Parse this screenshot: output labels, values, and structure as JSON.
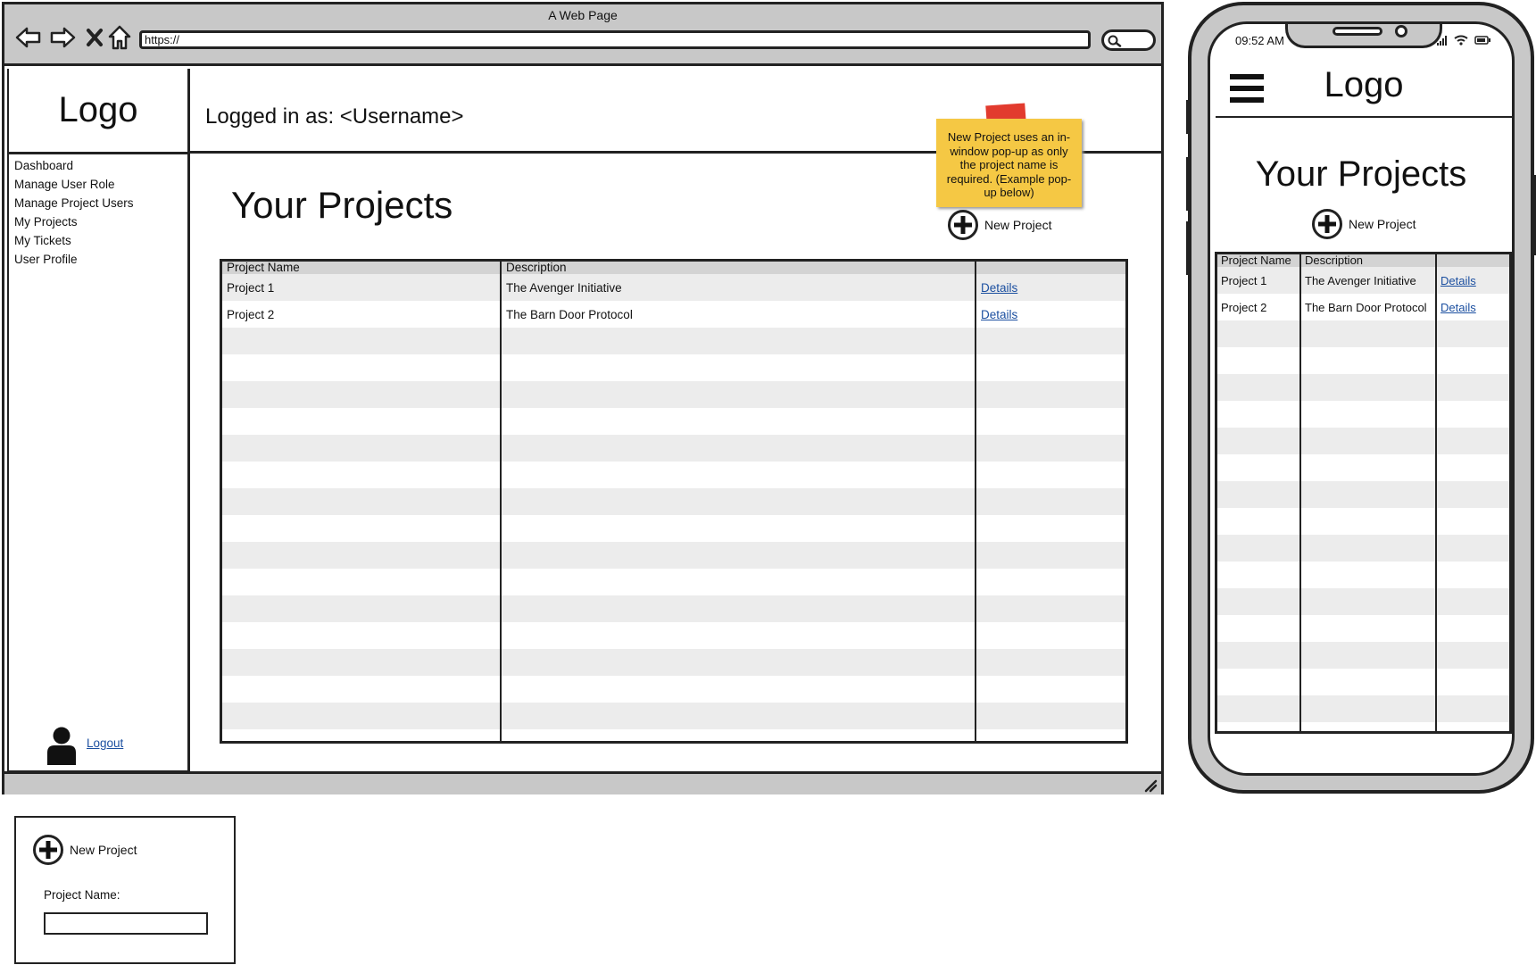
{
  "browser": {
    "window_title": "A Web Page",
    "address": "https://"
  },
  "sidebar": {
    "logo": "Logo",
    "items": [
      {
        "label": "Dashboard"
      },
      {
        "label": "Manage User Role"
      },
      {
        "label": "Manage Project Users"
      },
      {
        "label": "My Projects"
      },
      {
        "label": "My Tickets"
      },
      {
        "label": "User Profile"
      }
    ],
    "logout_label": "Logout"
  },
  "header": {
    "logged_in_text": "Logged in as: <Username>"
  },
  "sticky_note": {
    "text": "New Project uses an in-window pop-up as only the project name is required. (Example pop-up below)"
  },
  "main": {
    "title": "Your Projects",
    "new_project_label": "New Project",
    "table": {
      "columns": [
        "Project Name",
        "Description",
        ""
      ],
      "rows": [
        {
          "name": "Project 1",
          "description": "The Avenger Initiative",
          "link": "Details"
        },
        {
          "name": "Project 2",
          "description": "The Barn Door Protocol",
          "link": "Details"
        }
      ]
    }
  },
  "mobile": {
    "time": "09:52 AM",
    "logo": "Logo",
    "title": "Your Projects",
    "new_project_label": "New Project",
    "table": {
      "columns": [
        "Project Name",
        "Description",
        ""
      ],
      "rows": [
        {
          "name": "Project 1",
          "description": "The Avenger Initiative",
          "link": "Details"
        },
        {
          "name": "Project 2",
          "description": "The Barn Door Protocol",
          "link": "Details"
        }
      ]
    }
  },
  "popup": {
    "title": "New Project",
    "field_label": "Project Name:",
    "field_value": ""
  },
  "icons": {
    "back": "arrow-left-icon",
    "forward": "arrow-right-icon",
    "close": "close-icon",
    "home": "home-icon",
    "search": "search-icon",
    "add": "plus-circle-icon",
    "user": "user-icon",
    "menu": "hamburger-icon"
  },
  "colors": {
    "chrome": "#c8c8c8",
    "sticky": "#f5c844",
    "tape": "#e23b2e",
    "link": "#1b4fa0",
    "row_stripe": "#ececec"
  }
}
